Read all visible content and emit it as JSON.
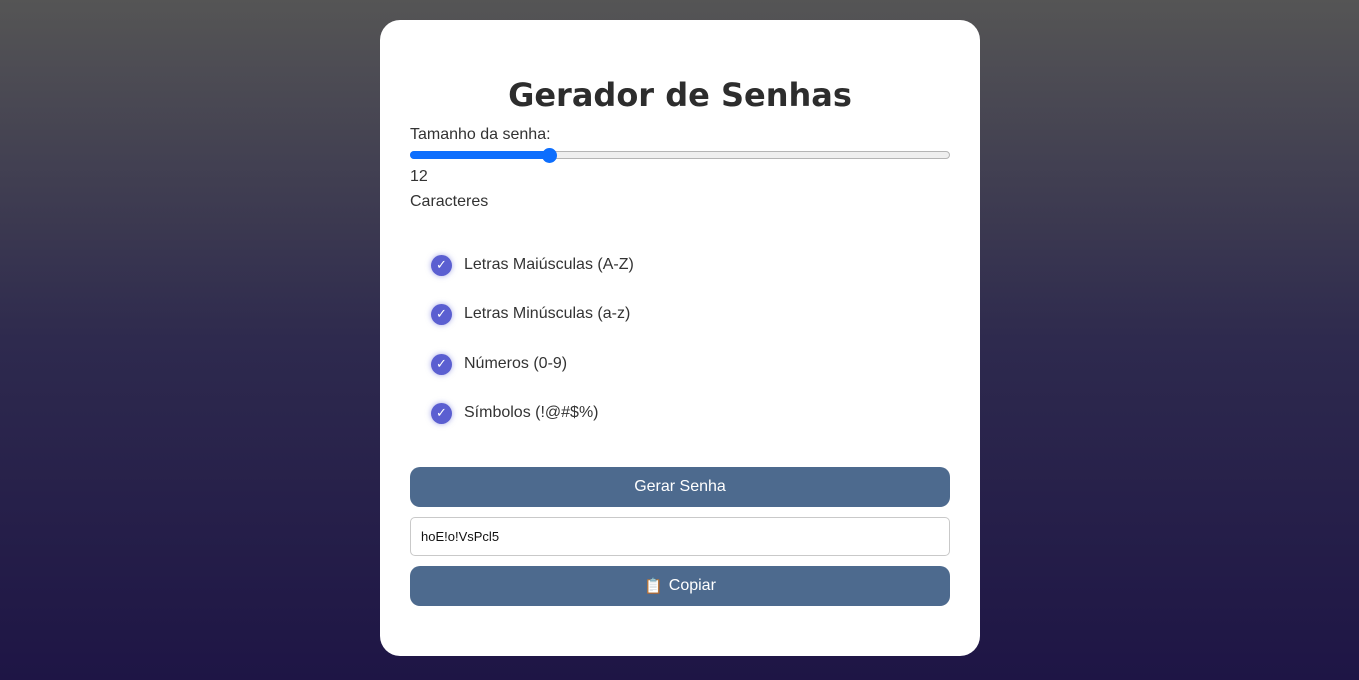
{
  "app": {
    "title": "Gerador de Senhas"
  },
  "length": {
    "label": "Tamanho da senha:",
    "value": "12",
    "unit": "Caracteres",
    "slider_fraction": 0.257
  },
  "options": [
    {
      "label": "Letras Maiúsculas (A-Z)",
      "checked": true
    },
    {
      "label": "Letras Minúsculas (a-z)",
      "checked": true
    },
    {
      "label": "Números (0-9)",
      "checked": true
    },
    {
      "label": "Símbolos (!@#$%)",
      "checked": true
    }
  ],
  "check_icon": "check-icon",
  "actions": {
    "generate_label": "Gerar Senha",
    "copy_label": "Copiar",
    "copy_icon": "clipboard-icon"
  },
  "output": {
    "password": "hoE!o!VsPcl5"
  },
  "colors": {
    "accent_button": "#4d6a8e",
    "slider": "#0d6efd",
    "checkbox": "#5b5fd1"
  }
}
